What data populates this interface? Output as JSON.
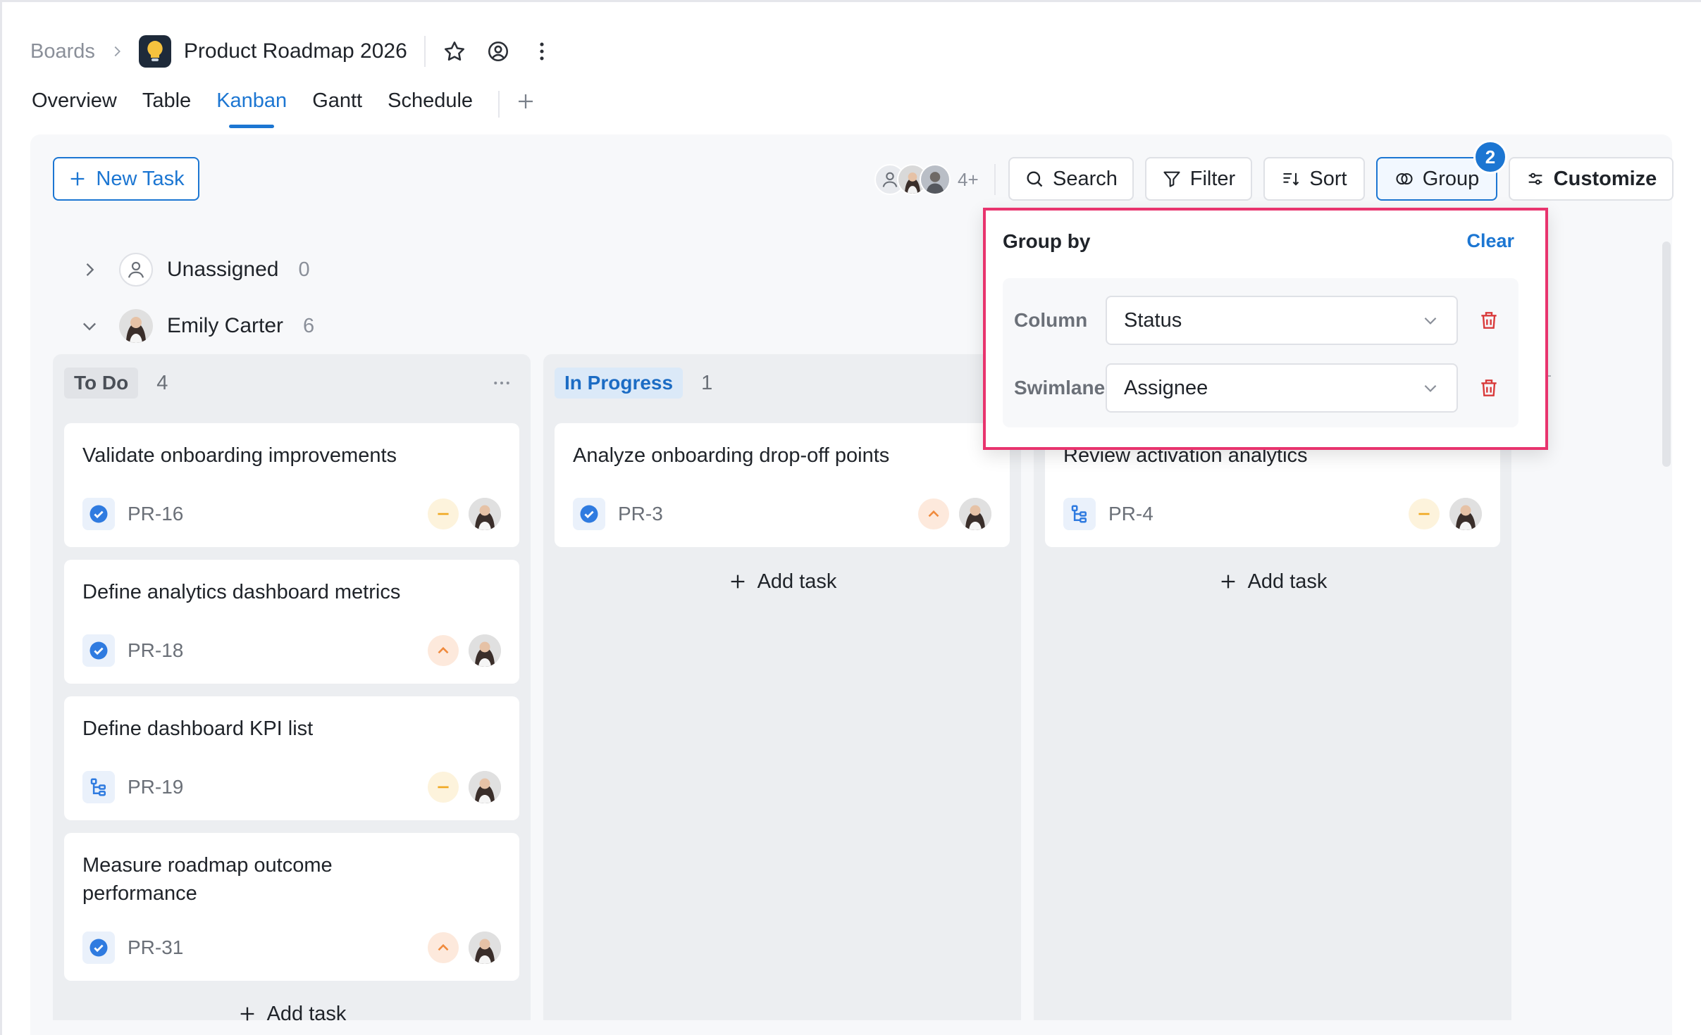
{
  "breadcrumb": {
    "root": "Boards",
    "title": "Product Roadmap 2026"
  },
  "tabs": [
    "Overview",
    "Table",
    "Kanban",
    "Gantt",
    "Schedule"
  ],
  "active_tab": "Kanban",
  "toolbar": {
    "new_task": "New Task",
    "members_more": "4+",
    "search": "Search",
    "filter": "Filter",
    "sort": "Sort",
    "group": "Group",
    "group_badge": "2",
    "customize": "Customize"
  },
  "swimlanes": [
    {
      "name": "Unassigned",
      "count": "0",
      "expanded": false
    },
    {
      "name": "Emily Carter",
      "count": "6",
      "expanded": true
    }
  ],
  "columns": [
    {
      "name": "To Do",
      "count": "4",
      "cards": [
        {
          "title": "Validate onboarding improvements",
          "id": "PR-16",
          "type": "check-icon",
          "priority": "medium"
        },
        {
          "title": "Define analytics dashboard metrics",
          "id": "PR-18",
          "type": "check-icon",
          "priority": "high"
        },
        {
          "title": "Define dashboard KPI list",
          "id": "PR-19",
          "type": "subtask-icon",
          "priority": "medium"
        },
        {
          "title": "Measure roadmap outcome performance",
          "id": "PR-31",
          "type": "check-icon",
          "priority": "high"
        }
      ],
      "add_label": "Add task"
    },
    {
      "name": "In Progress",
      "count": "1",
      "cards": [
        {
          "title": "Analyze onboarding drop-off points",
          "id": "PR-3",
          "type": "check-icon",
          "priority": "high"
        }
      ],
      "add_label": "Add task"
    },
    {
      "name": "",
      "cards": [
        {
          "title": "Review activation analytics",
          "id": "PR-4",
          "type": "subtask-icon",
          "priority": "medium"
        }
      ],
      "add_label": "Add task"
    }
  ],
  "group_popover": {
    "title": "Group by",
    "clear": "Clear",
    "rows": [
      {
        "label": "Column",
        "value": "Status"
      },
      {
        "label": "Swimlane",
        "value": "Assignee"
      }
    ]
  },
  "colors": {
    "accent": "#1c76d2",
    "highlight": "#e8346e",
    "priority_medium": "#f0a820",
    "priority_high": "#f08a3c",
    "delete": "#d93a3a"
  }
}
